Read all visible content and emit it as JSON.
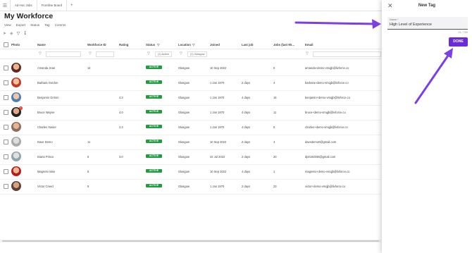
{
  "tabs": [
    {
      "label": "Ad-Hoc Jobs"
    },
    {
      "label": "Frontline Board"
    }
  ],
  "add_tab": "+",
  "page_title": "My Workforce",
  "menu": [
    "View",
    "Export",
    "Status",
    "Tag",
    "Comms"
  ],
  "columns": {
    "photo": "Photo",
    "name": "Name",
    "workforce_id": "Workforce ID",
    "rating": "Rating",
    "status": "Status",
    "location": "Location",
    "joined": "Joined",
    "last_job": "Last job",
    "jobs_last": "Jobs (last 90…",
    "email": "Email"
  },
  "filters": {
    "status": "(1) Active",
    "location": "(1) Glasgow"
  },
  "rows": [
    {
      "name": "Amanda Jean",
      "workforce_id": "14",
      "rating": "",
      "status": "ACTIVE",
      "location": "Glasgow",
      "joined": "10 Sep 2022",
      "last_job": "",
      "jobs": "0",
      "email": "amanda+demo-vmqjb@livforce.co"
    },
    {
      "name": "Barbara Gordon",
      "workforce_id": "",
      "rating": "",
      "status": "ACTIVE",
      "location": "Glasgow",
      "joined": "1 Jan 1970",
      "last_job": "2 days",
      "jobs": "4",
      "email": "barbara+demo-vmqjb@livforce.co"
    },
    {
      "name": "Benjamin Grimm",
      "workforce_id": "",
      "rating": "4.3",
      "status": "ACTIVE",
      "location": "Glasgow",
      "joined": "1 Jan 1970",
      "last_job": "4 days",
      "jobs": "16",
      "email": "benjamin+demo-vmqjb@livforce.co"
    },
    {
      "name": "Bruce Wayne",
      "workforce_id": "",
      "rating": "4.0",
      "status": "ACTIVE",
      "location": "Glasgow",
      "joined": "1 Jan 1970",
      "last_job": "4 days",
      "jobs": "11",
      "email": "bruce+demo-vmqjb@livforce.co"
    },
    {
      "name": "Charles Xavier",
      "workforce_id": "",
      "rating": "2.3",
      "status": "ACTIVE",
      "location": "Glasgow",
      "joined": "1 Jan 1970",
      "last_job": "4 days",
      "jobs": "5",
      "email": "charles+demo-vmqjb@livforce.co"
    },
    {
      "name": "Dave Demo",
      "workforce_id": "11",
      "rating": "",
      "status": "ACTIVE",
      "location": "Glasgow",
      "joined": "10 Sep 2022",
      "last_job": "2 days",
      "jobs": "4",
      "email": "davedemo0@gmail.com"
    },
    {
      "name": "Diana Prince",
      "workforce_id": "6",
      "rating": "3.0",
      "status": "ACTIVE",
      "location": "Glasgow",
      "joined": "22 Jul 2022",
      "last_job": "2 days",
      "jobs": "20",
      "email": "dp0192038@gmail.com"
    },
    {
      "name": "Magneto Man",
      "workforce_id": "8",
      "rating": "",
      "status": "ACTIVE",
      "location": "Glasgow",
      "joined": "10 Sep 2022",
      "last_job": "4 days",
      "jobs": "1",
      "email": "magneto+demo-vmqjb@livforce.co"
    },
    {
      "name": "Victor Creed",
      "workforce_id": "9",
      "rating": "",
      "status": "ACTIVE",
      "location": "Glasgow",
      "joined": "1 Jan 1970",
      "last_job": "2 days",
      "jobs": "23",
      "email": "victor+demo-vmqjb@livforce.co"
    }
  ],
  "notification_count": "2",
  "panel": {
    "title": "New Tag",
    "field_label": "Name *",
    "field_value": "High Level of Experience",
    "counter": "24 / 255",
    "done_label": "DONE"
  },
  "colors": {
    "accent": "#6c2bd9",
    "active": "#1e9e3e",
    "arrow": "#7b3fe4"
  },
  "icons": {
    "menu": "hamburger-icon",
    "close": "close-icon",
    "filter": "filter-icon",
    "download": "download-icon",
    "send": "send-icon",
    "tag": "tag-icon"
  }
}
